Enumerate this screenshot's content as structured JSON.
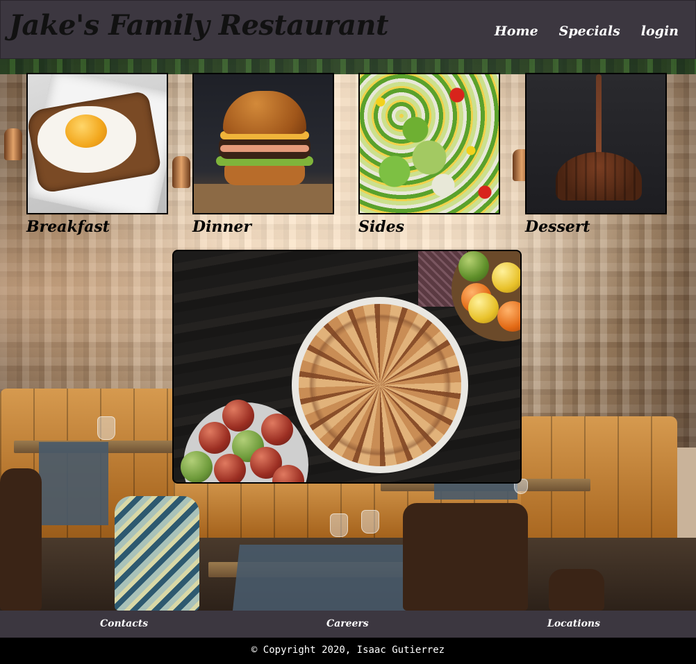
{
  "header": {
    "title": "Jake's Family Restaurant",
    "nav": [
      "Home",
      "Specials",
      "login"
    ]
  },
  "menu": {
    "categories": [
      "Breakfast",
      "Dinner",
      "Sides",
      "Dessert"
    ]
  },
  "footer": {
    "links": [
      "Contacts",
      "Careers",
      "Locations"
    ],
    "copyright": "© Copyright 2020, Isaac Gutierrez"
  },
  "colors": {
    "header_bg": "#3c3740",
    "nav_text": "#ffffff",
    "title_text": "#111111",
    "copyright_bg": "#000000"
  }
}
